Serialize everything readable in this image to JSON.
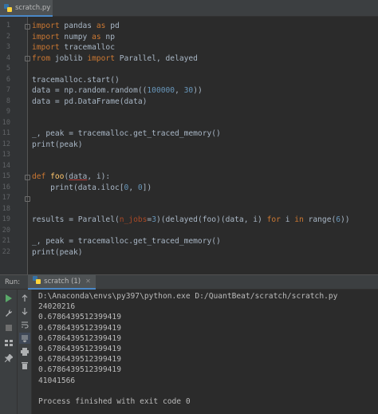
{
  "editor_tab": {
    "filename": "scratch.py"
  },
  "code_lines": [
    {
      "n": "1"
    },
    {
      "n": "2"
    },
    {
      "n": "3"
    },
    {
      "n": "4"
    },
    {
      "n": "5"
    },
    {
      "n": "6"
    },
    {
      "n": "7"
    },
    {
      "n": "8"
    },
    {
      "n": "9"
    },
    {
      "n": "10"
    },
    {
      "n": "11"
    },
    {
      "n": "12"
    },
    {
      "n": "13"
    },
    {
      "n": "14"
    },
    {
      "n": "15"
    },
    {
      "n": "16"
    },
    {
      "n": "17"
    },
    {
      "n": "18"
    },
    {
      "n": "19"
    },
    {
      "n": "20"
    },
    {
      "n": "21"
    },
    {
      "n": "22"
    }
  ],
  "code": {
    "l1": [
      "import",
      " pandas ",
      "as",
      " pd"
    ],
    "l2": [
      "import",
      " numpy ",
      "as",
      " np"
    ],
    "l3": [
      "import",
      " tracemalloc"
    ],
    "l4": [
      "from",
      " joblib ",
      "import",
      " Parallel, delayed"
    ],
    "l6": "tracemalloc.start()",
    "l7": [
      "data = np.random.random((",
      "100000",
      ", ",
      "30",
      "))"
    ],
    "l8": "data = pd.DataFrame(data)",
    "l11": "_, peak = tracemalloc.get_traced_memory()",
    "l12": "print(peak)",
    "l15": [
      "def",
      " ",
      "foo",
      "(",
      "data",
      ", i):"
    ],
    "l16": [
      "    print(data.iloc[",
      "0",
      ", ",
      "0",
      "])"
    ],
    "l19": [
      "results = Parallel(",
      "n_jobs",
      "=",
      "3",
      ")(delayed(foo)(data, i) ",
      "for",
      " i ",
      "in",
      " range(",
      "6",
      "))"
    ],
    "l21": "_, peak = tracemalloc.get_traced_memory()",
    "l22": "print(peak)"
  },
  "run_panel": {
    "label": "Run:",
    "tab_name": "scratch (1)",
    "output": [
      "D:\\Anaconda\\envs\\py397\\python.exe D:/QuantBeat/scratch/scratch.py",
      "24020216",
      "0.6786439512399419",
      "0.6786439512399419",
      "0.6786439512399419",
      "0.6786439512399419",
      "0.6786439512399419",
      "0.6786439512399419",
      "41041566",
      "",
      "Process finished with exit code 0"
    ]
  },
  "colors": {
    "background": "#2b2b2b",
    "keyword": "#cc7832",
    "function": "#ffc66d",
    "number": "#6897bb",
    "parameter": "#aa4926",
    "run_green": "#59a869"
  }
}
